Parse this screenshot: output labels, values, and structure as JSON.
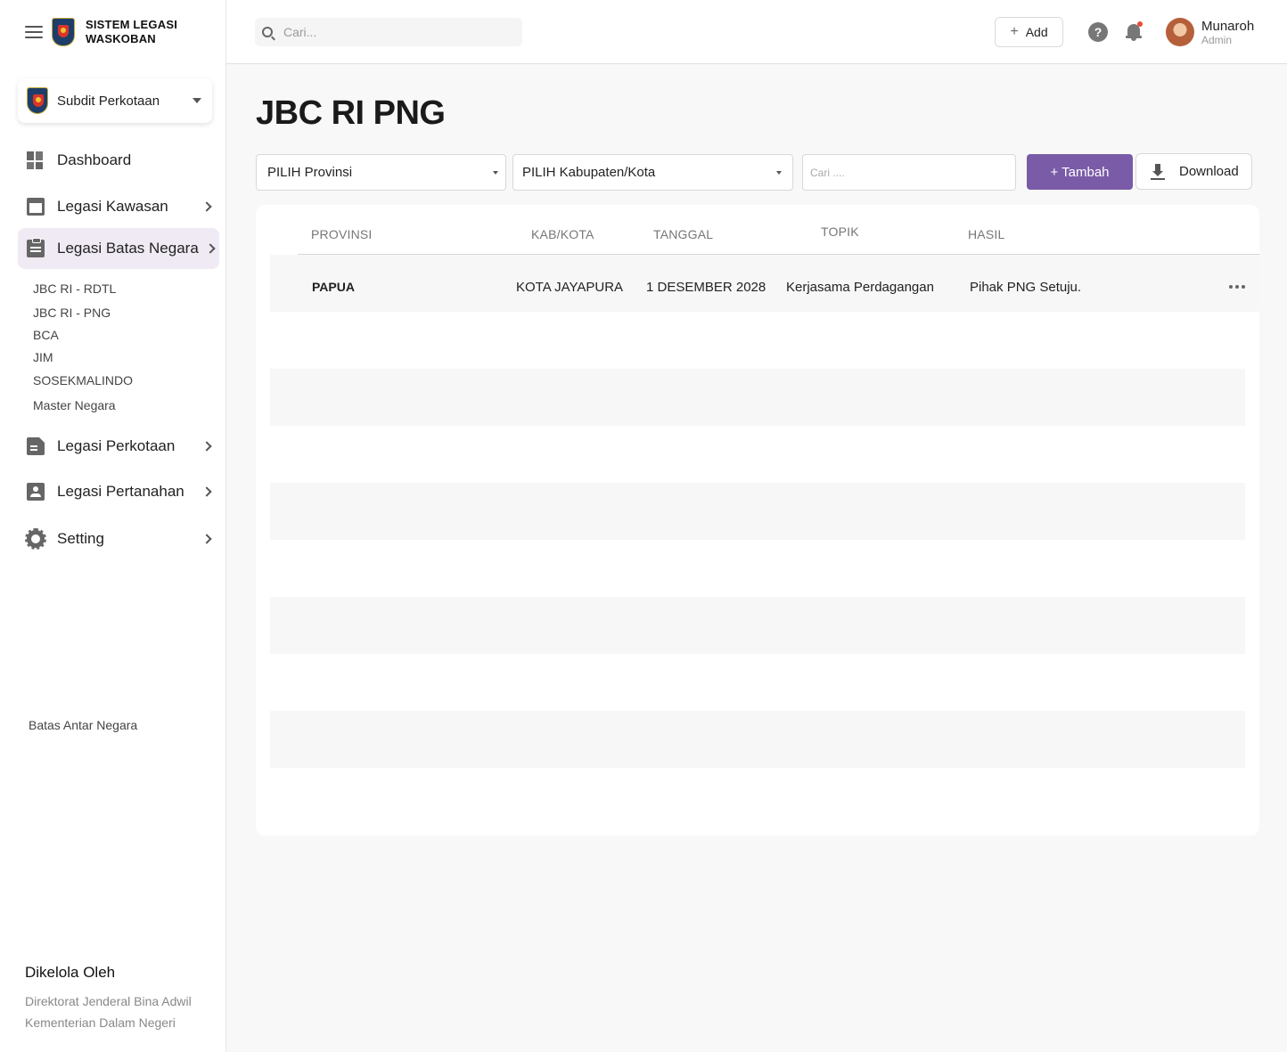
{
  "app": {
    "brand_line1": "SISTEM LEGASI",
    "brand_line2": "WASKOBAN"
  },
  "unit": {
    "selected": "Subdit Perkotaan"
  },
  "nav": [
    {
      "label": "Dashboard",
      "icon": "dashboard-icon",
      "active": false,
      "has_submenu": false
    },
    {
      "label": "Legasi Kawasan",
      "icon": "store-icon",
      "active": false,
      "has_submenu": true
    },
    {
      "label": "Legasi Batas Negara",
      "icon": "clipboard-icon",
      "active": true,
      "has_submenu": true
    },
    {
      "label": "Legasi Perkotaan",
      "icon": "document-icon",
      "active": false,
      "has_submenu": true
    },
    {
      "label": "Legasi Pertanahan",
      "icon": "badge-icon",
      "active": false,
      "has_submenu": true
    },
    {
      "label": "Setting",
      "icon": "gear-icon",
      "active": false,
      "has_submenu": true
    }
  ],
  "subnav": [
    "JBC RI - RDTL",
    "JBC RI - PNG",
    "BCA",
    "JIM",
    "SOSEKMALINDO",
    "Master Negara"
  ],
  "sidebar_note": "Batas Antar Negara",
  "managed_by": {
    "title": "Dikelola Oleh",
    "line1": "Direktorat Jenderal Bina Adwil",
    "line2": "Kementerian Dalam Negeri"
  },
  "topbar": {
    "search_placeholder": "Cari...",
    "add_label": "Add",
    "help_glyph": "?",
    "user_name": "Munaroh",
    "user_role": "Admin"
  },
  "page": {
    "title": "JBC RI PNG",
    "province_select": "PILIH Provinsi",
    "city_select": "PILIH Kabupaten/Kota",
    "search_placeholder": "Cari ....",
    "add_button": "+ Tambah",
    "download_button": "Download"
  },
  "table": {
    "headers": [
      "PROVINSI",
      "KAB/KOTA",
      "TANGGAL",
      "TOPIK",
      "HASIL"
    ],
    "rows": [
      {
        "provinsi": "PAPUA",
        "kab_kota": "KOTA JAYAPURA",
        "tanggal": "1 DESEMBER 2028",
        "topik": "Kerjasama Perdagangan",
        "hasil": "Pihak PNG Setuju."
      }
    ]
  },
  "colors": {
    "accent": "#7a5ba8",
    "active_nav_bg": "#efeaf3",
    "notification_dot": "#e74c3c"
  }
}
